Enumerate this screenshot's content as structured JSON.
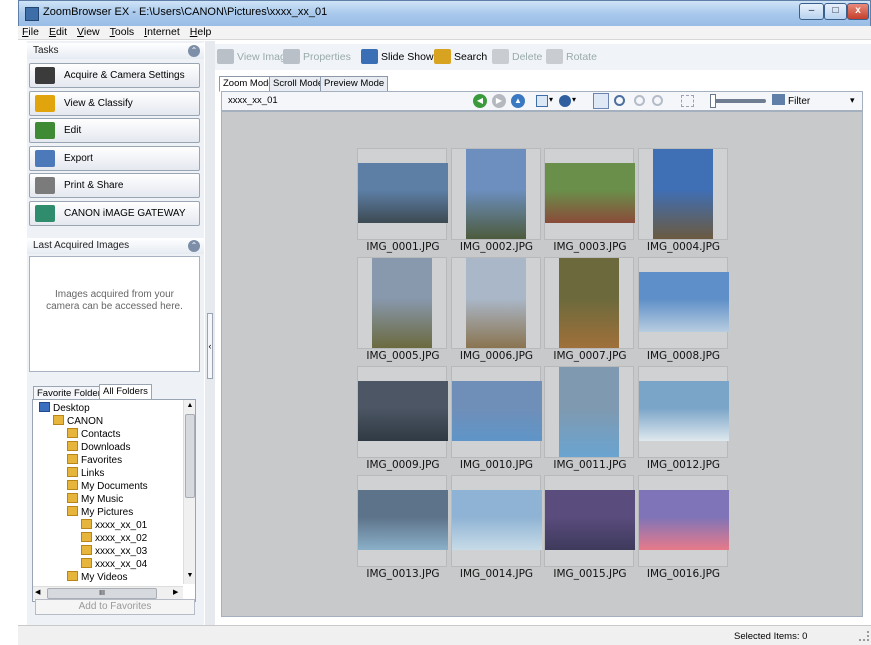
{
  "window": {
    "title": "ZoomBrowser EX  -  E:\\Users\\CANON\\Pictures\\xxxx_xx_01",
    "min": "–",
    "max": "□",
    "close": "x"
  },
  "menu": [
    "File",
    "Edit",
    "View",
    "Tools",
    "Internet",
    "Help"
  ],
  "left": {
    "tasks_title": "Tasks",
    "collapse_glyph": "⌃",
    "tasks": [
      {
        "label": "Acquire & Camera Settings",
        "icon": "camera-icon",
        "color": "#3b3b3b"
      },
      {
        "label": "View & Classify",
        "icon": "view-classify-icon",
        "color": "#e2a40d"
      },
      {
        "label": "Edit",
        "icon": "edit-icon",
        "color": "#3f8a35"
      },
      {
        "label": "Export",
        "icon": "export-icon",
        "color": "#4b79b9"
      },
      {
        "label": "Print & Share",
        "icon": "printer-icon",
        "color": "#7b7b7b"
      },
      {
        "label": "CANON iMAGE GATEWAY",
        "icon": "image-gateway-icon",
        "color": "#2f8d6e"
      }
    ],
    "last_acquired_title": "Last Acquired Images",
    "last_acquired_text": "Images acquired from your camera can be accessed here.",
    "tabs": [
      "Favorite Folders",
      "All Folders"
    ],
    "tree": [
      {
        "label": "Desktop",
        "indent": 0,
        "icon": "desktop-icon"
      },
      {
        "label": "CANON",
        "indent": 1,
        "icon": "user-folder-icon"
      },
      {
        "label": "Contacts",
        "indent": 2,
        "icon": "contacts-icon"
      },
      {
        "label": "Downloads",
        "indent": 2,
        "icon": "downloads-icon"
      },
      {
        "label": "Favorites",
        "indent": 2,
        "icon": "favorites-icon"
      },
      {
        "label": "Links",
        "indent": 2,
        "icon": "links-icon"
      },
      {
        "label": "My Documents",
        "indent": 2,
        "icon": "documents-icon"
      },
      {
        "label": "My Music",
        "indent": 2,
        "icon": "music-icon"
      },
      {
        "label": "My Pictures",
        "indent": 2,
        "icon": "pictures-icon"
      },
      {
        "label": "xxxx_xx_01",
        "indent": 3,
        "icon": "folder-icon"
      },
      {
        "label": "xxxx_xx_02",
        "indent": 3,
        "icon": "folder-icon"
      },
      {
        "label": "xxxx_xx_03",
        "indent": 3,
        "icon": "folder-icon"
      },
      {
        "label": "xxxx_xx_04",
        "indent": 3,
        "icon": "folder-icon"
      },
      {
        "label": "My Videos",
        "indent": 2,
        "icon": "videos-icon"
      }
    ],
    "hscroll_label": "III",
    "add_favorites": "Add to Favorites"
  },
  "toolbar": [
    {
      "label": "View Image",
      "enabled": false,
      "icon": "view-image-icon"
    },
    {
      "label": "Properties",
      "enabled": false,
      "icon": "properties-icon"
    },
    {
      "label": "Slide Show",
      "enabled": true,
      "icon": "slideshow-icon"
    },
    {
      "label": "Search",
      "enabled": true,
      "icon": "search-icon"
    },
    {
      "label": "Delete",
      "enabled": false,
      "icon": "delete-icon"
    },
    {
      "label": "Rotate",
      "enabled": false,
      "icon": "rotate-icon"
    }
  ],
  "mode_tabs": [
    "Zoom Mode",
    "Scroll Mode",
    "Preview Mode"
  ],
  "viewbar": {
    "path": "xxxx_xx_01",
    "filter": "Filter",
    "dropdown": "▾"
  },
  "thumbnails": [
    {
      "name": "IMG_0001.JPG",
      "orient": "landscape",
      "sky": "#5d7fa6",
      "ground": "#3d4a52"
    },
    {
      "name": "IMG_0002.JPG",
      "orient": "portrait",
      "sky": "#6c8fbf",
      "ground": "#4d5b3d"
    },
    {
      "name": "IMG_0003.JPG",
      "orient": "landscape",
      "sky": "#6a8f4a",
      "ground": "#8a4b3a"
    },
    {
      "name": "IMG_0004.JPG",
      "orient": "portrait",
      "sky": "#3f6fb5",
      "ground": "#6b5a40"
    },
    {
      "name": "IMG_0005.JPG",
      "orient": "portrait",
      "sky": "#8898ad",
      "ground": "#6b6a3f"
    },
    {
      "name": "IMG_0006.JPG",
      "orient": "portrait",
      "sky": "#aab7c8",
      "ground": "#8a7450"
    },
    {
      "name": "IMG_0007.JPG",
      "orient": "portrait",
      "sky": "#6c6a3c",
      "ground": "#a0703a"
    },
    {
      "name": "IMG_0008.JPG",
      "orient": "landscape",
      "sky": "#5f8fc8",
      "ground": "#b8cde0"
    },
    {
      "name": "IMG_0009.JPG",
      "orient": "landscape",
      "sky": "#4c5664",
      "ground": "#2f3a44"
    },
    {
      "name": "IMG_0010.JPG",
      "orient": "landscape",
      "sky": "#6f8fb8",
      "ground": "#5f95c8"
    },
    {
      "name": "IMG_0011.JPG",
      "orient": "portrait",
      "sky": "#7f99b0",
      "ground": "#6aa4d0"
    },
    {
      "name": "IMG_0012.JPG",
      "orient": "landscape",
      "sky": "#7aa5c8",
      "ground": "#dfe8ee"
    },
    {
      "name": "IMG_0013.JPG",
      "orient": "landscape",
      "sky": "#5d738a",
      "ground": "#8ab0c8"
    },
    {
      "name": "IMG_0014.JPG",
      "orient": "landscape",
      "sky": "#8fb3d4",
      "ground": "#c7dbe8"
    },
    {
      "name": "IMG_0015.JPG",
      "orient": "landscape",
      "sky": "#5a4c7d",
      "ground": "#3d3a5c"
    },
    {
      "name": "IMG_0016.JPG",
      "orient": "landscape",
      "sky": "#7f74b8",
      "ground": "#e77a8a"
    }
  ],
  "status": {
    "selected": "Selected Items: 0"
  }
}
